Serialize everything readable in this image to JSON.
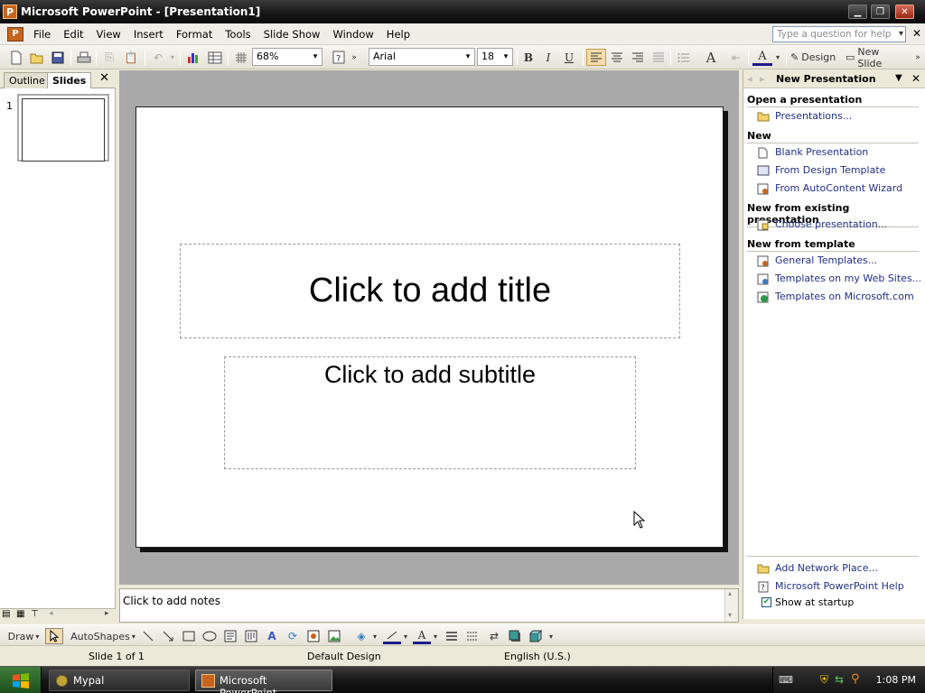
{
  "window": {
    "title": "Microsoft PowerPoint - [Presentation1]",
    "app_icon_letter": "P",
    "minimize": "▁",
    "maximize": "❐",
    "close": "✕"
  },
  "menu": {
    "items": [
      "File",
      "Edit",
      "View",
      "Insert",
      "Format",
      "Tools",
      "Slide Show",
      "Window",
      "Help"
    ],
    "help_placeholder": "Type a question for help",
    "close_doc": "✕"
  },
  "toolbar": {
    "zoom": "68%",
    "font": "Arial",
    "size": "18",
    "bold": "B",
    "italic": "I",
    "underline": "U",
    "design_label": "Design",
    "new_slide_label": "New Slide"
  },
  "left_pane": {
    "tabs": [
      "Outline",
      "Slides"
    ],
    "active_tab": "Slides",
    "close": "✕",
    "slide_number": "1"
  },
  "slide": {
    "title_placeholder": "Click to add title",
    "subtitle_placeholder": "Click to add subtitle"
  },
  "notes": {
    "placeholder": "Click to add notes"
  },
  "task_pane": {
    "title": "New Presentation",
    "sections": {
      "open": {
        "heading": "Open a presentation",
        "links": [
          "Presentations..."
        ]
      },
      "new": {
        "heading": "New",
        "links": [
          "Blank Presentation",
          "From Design Template",
          "From AutoContent Wizard"
        ]
      },
      "existing": {
        "heading": "New from existing presentation",
        "links": [
          "Choose presentation..."
        ]
      },
      "template": {
        "heading": "New from template",
        "links": [
          "General Templates...",
          "Templates on my Web Sites...",
          "Templates on Microsoft.com"
        ]
      }
    },
    "footer": {
      "links": [
        "Add Network Place...",
        "Microsoft PowerPoint Help"
      ],
      "show_at_startup": "Show at startup",
      "show_at_startup_checked": true
    }
  },
  "draw_toolbar": {
    "draw_label": "Draw",
    "autoshapes_label": "AutoShapes"
  },
  "status": {
    "slide": "Slide 1 of 1",
    "design": "Default Design",
    "language": "English (U.S.)"
  },
  "taskbar": {
    "tasks": [
      "Mypal",
      "Microsoft PowerPoint -..."
    ],
    "clock": "1:08 PM"
  },
  "colors": {
    "link": "#1f2f8a",
    "title_bar": "#151515",
    "canvas_bg": "#a9a9a9",
    "taskbar": "#171717"
  }
}
